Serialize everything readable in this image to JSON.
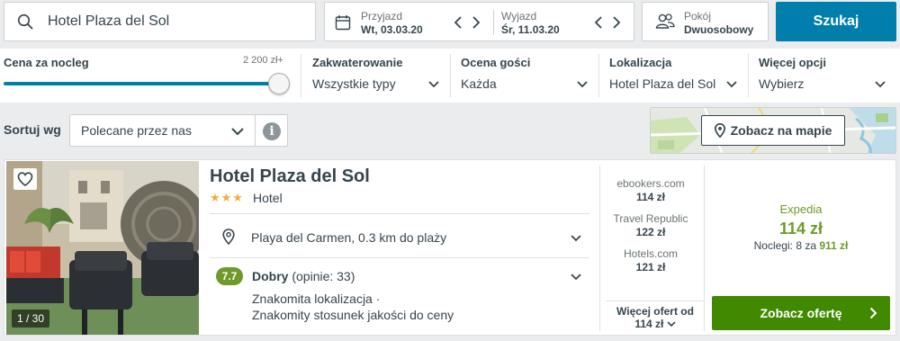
{
  "search": {
    "query": "Hotel Plaza del Sol"
  },
  "dates": {
    "checkin_label": "Przyjazd",
    "checkin_value": "Wt, 03.03.20",
    "checkout_label": "Wyjazd",
    "checkout_value": "Śr, 11.03.20"
  },
  "guests": {
    "label": "Pokój",
    "value": "Dwuosobowy"
  },
  "search_button": "Szukaj",
  "filters": {
    "price": {
      "title": "Cena za nocleg",
      "max": "2 200 zł+"
    },
    "accommodation": {
      "title": "Zakwaterowanie",
      "value": "Wszystkie typy"
    },
    "rating": {
      "title": "Ocena gości",
      "value": "Każda"
    },
    "location": {
      "title": "Lokalizacja",
      "value": "Hotel Plaza del Sol"
    },
    "more": {
      "title": "Więcej opcji",
      "value": "Wybierz"
    }
  },
  "sort": {
    "label": "Sortuj wg",
    "value": "Polecane przez nas"
  },
  "map_button": "Zobacz na mapie",
  "hotel": {
    "photo_counter": "1 / 30",
    "name": "Hotel Plaza del Sol",
    "stars": "★★★",
    "type": "Hotel",
    "location": "Playa del Carmen, 0.3 km do plaży",
    "rating_score": "7.7",
    "rating_label": "Dobry",
    "rating_reviews": "(opinie: 33)",
    "features": [
      "Znakomita lokalizacja ·",
      "Znakomity stosunek jakości do ceny"
    ],
    "deals": [
      {
        "provider": "ebookers.com",
        "price": "114 zł"
      },
      {
        "provider": "Travel Republic",
        "price": "122 zł"
      },
      {
        "provider": "Hotels.com",
        "price": "121 zł"
      }
    ],
    "more_offers_label": "Więcej ofert od",
    "more_offers_price": "114 zł",
    "best": {
      "provider": "Expedia",
      "price": "114 zł",
      "nights_prefix": "Noclegi: 8 za",
      "nights_total": "911 zł"
    },
    "offer_button": "Zobacz ofertę"
  },
  "colors": {
    "primary": "#007fad",
    "success": "#418901",
    "rating": "#6f9a2b",
    "star": "#f6ab3f"
  }
}
